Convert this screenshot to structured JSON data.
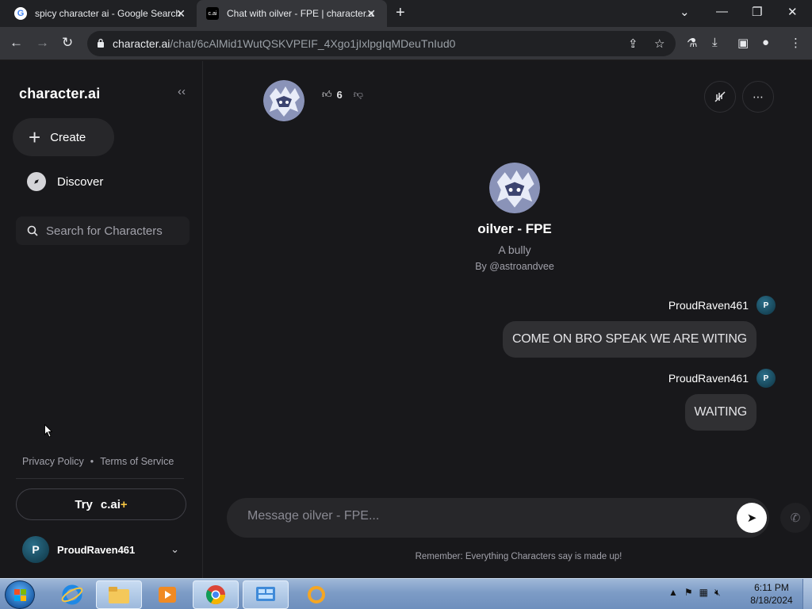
{
  "browser": {
    "tabs": [
      {
        "title": "spicy character ai - Google Search",
        "favicon": "google-g-icon"
      },
      {
        "title": "Chat with oilver - FPE | character.ai",
        "favicon": "cai-icon",
        "favicon_text": "c.ai",
        "active": true
      }
    ],
    "url_host": "character.ai",
    "url_path": "/chat/6cAlMid1WutQSKVPEIF_4Xgo1jIxlpgIqMDeuTnIud0"
  },
  "sidebar": {
    "brand": "character.ai",
    "create_label": "Create",
    "discover_label": "Discover",
    "search_placeholder": "Search for Characters",
    "privacy_label": "Privacy Policy",
    "separator": "•",
    "terms_label": "Terms of Service",
    "try_label": "Try",
    "try_brand": "c.ai",
    "try_plus": "+",
    "user": {
      "initial": "P",
      "name": "ProudRaven461"
    }
  },
  "chat": {
    "like_count": "6",
    "character": {
      "name": "oilver - FPE",
      "tagline": "A bully",
      "creator": "By @astroandvee"
    },
    "messages": [
      {
        "author": "ProudRaven461",
        "initial": "P",
        "text": "COME ON BRO SPEAK WE ARE WITING"
      },
      {
        "author": "ProudRaven461",
        "initial": "P",
        "text": "WAITING"
      }
    ],
    "composer_placeholder": "Message oilver - FPE...",
    "disclaimer": "Remember: Everything Characters say is made up!"
  },
  "taskbar": {
    "time": "6:11 PM",
    "date": "8/18/2024"
  },
  "colors": {
    "background": "#18181b",
    "bubble": "#303033",
    "accent_plus": "#f5c542"
  }
}
